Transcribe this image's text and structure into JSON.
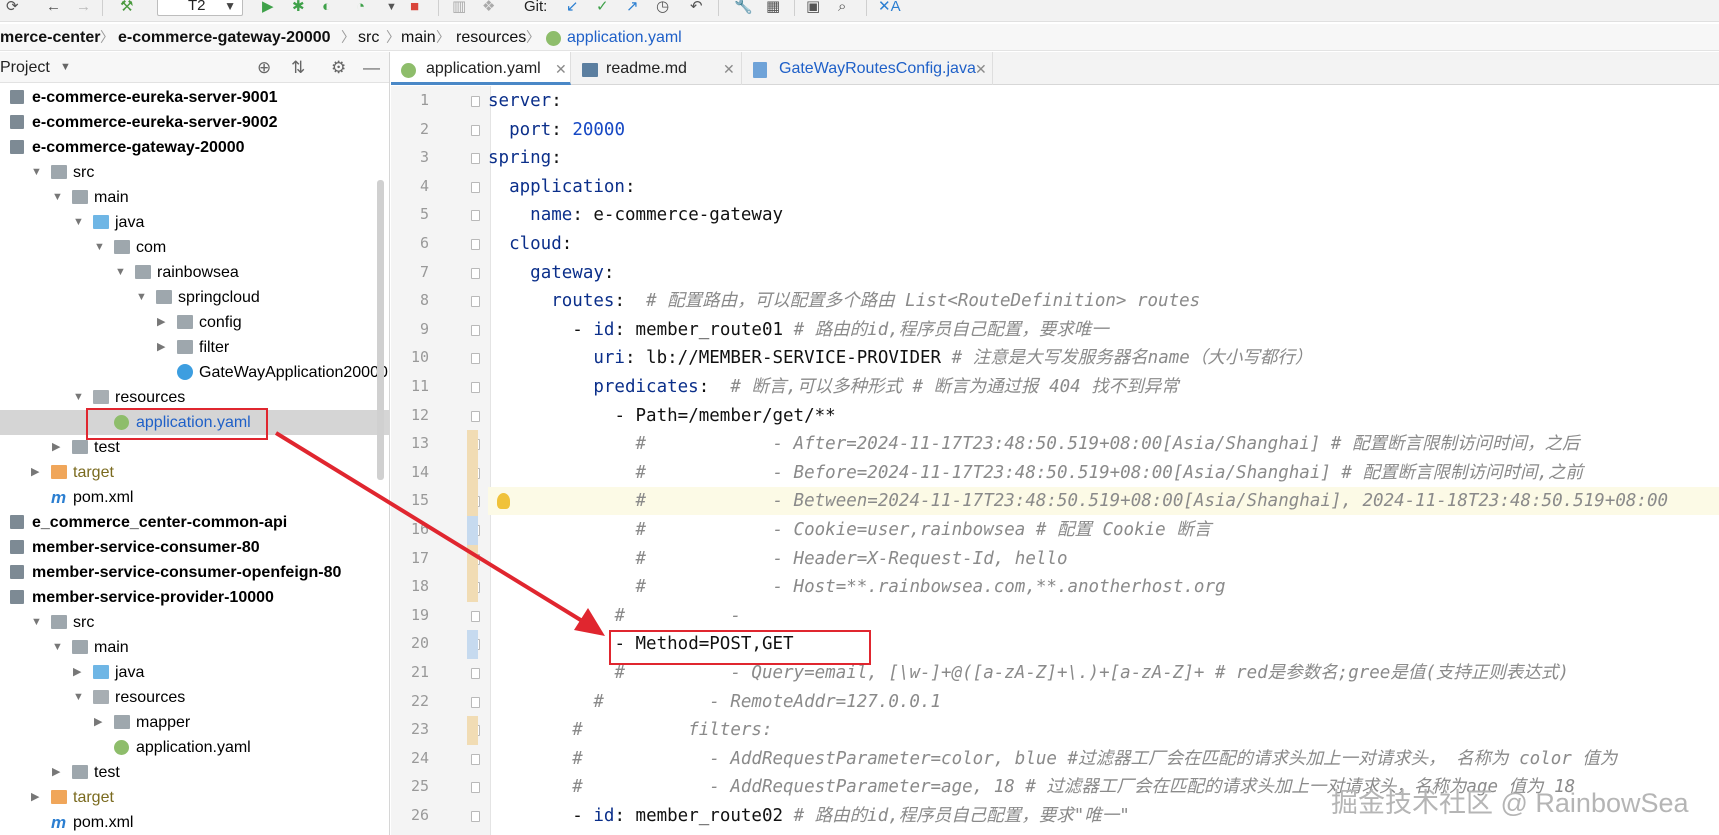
{
  "toolbar": {
    "run_config": "T2",
    "git_label": "Git:",
    "icons": [
      "sync-icon",
      "back-icon",
      "forward-icon",
      "hammer-icon",
      "run-icon",
      "debug-icon",
      "coverage-icon",
      "profile-icon",
      "stop-icon",
      "git-update-icon",
      "git-commit-icon",
      "git-push-icon",
      "history-icon",
      "rollback-icon",
      "settings-icon",
      "project-structure-icon",
      "terminal-icon",
      "search-icon",
      "translate-icon"
    ]
  },
  "breadcrumb": {
    "items": [
      "merce-center",
      "e-commerce-gateway-20000",
      "src",
      "main",
      "resources",
      "application.yaml"
    ]
  },
  "project_panel": {
    "title": "Project",
    "tree": [
      {
        "label": "e-commerce-eureka-server-9001",
        "depth": 0,
        "kind": "module",
        "arrow": "",
        "bold": true
      },
      {
        "label": "e-commerce-eureka-server-9002",
        "depth": 0,
        "kind": "module",
        "arrow": "",
        "bold": true
      },
      {
        "label": "e-commerce-gateway-20000",
        "depth": 0,
        "kind": "module",
        "arrow": "",
        "bold": true
      },
      {
        "label": "src",
        "depth": 1,
        "kind": "folder",
        "arrow": "open",
        "bold": false
      },
      {
        "label": "main",
        "depth": 2,
        "kind": "folder",
        "arrow": "open",
        "bold": false
      },
      {
        "label": "java",
        "depth": 3,
        "kind": "folder-blue",
        "arrow": "open",
        "bold": false
      },
      {
        "label": "com",
        "depth": 4,
        "kind": "folder",
        "arrow": "open",
        "bold": false
      },
      {
        "label": "rainbowsea",
        "depth": 5,
        "kind": "folder",
        "arrow": "open",
        "bold": false
      },
      {
        "label": "springcloud",
        "depth": 6,
        "kind": "folder",
        "arrow": "open",
        "bold": false
      },
      {
        "label": "config",
        "depth": 7,
        "kind": "folder",
        "arrow": "closed",
        "bold": false
      },
      {
        "label": "filter",
        "depth": 7,
        "kind": "folder",
        "arrow": "closed",
        "bold": false
      },
      {
        "label": "GateWayApplication20000",
        "depth": 7,
        "kind": "class",
        "arrow": "",
        "bold": false
      },
      {
        "label": "resources",
        "depth": 3,
        "kind": "folder-res",
        "arrow": "open",
        "bold": false
      },
      {
        "label": "application.yaml",
        "depth": 4,
        "kind": "yaml",
        "arrow": "",
        "bold": false,
        "selected": true
      },
      {
        "label": "test",
        "depth": 2,
        "kind": "folder",
        "arrow": "closed",
        "bold": false
      },
      {
        "label": "target",
        "depth": 1,
        "kind": "folder-orange",
        "arrow": "closed",
        "bold": false,
        "olive": true
      },
      {
        "label": "pom.xml",
        "depth": 1,
        "kind": "maven",
        "arrow": "",
        "bold": false
      },
      {
        "label": "e_commerce_center-common-api",
        "depth": 0,
        "kind": "module",
        "arrow": "",
        "bold": true
      },
      {
        "label": "member-service-consumer-80",
        "depth": 0,
        "kind": "module",
        "arrow": "",
        "bold": true
      },
      {
        "label": "member-service-consumer-openfeign-80",
        "depth": 0,
        "kind": "module",
        "arrow": "",
        "bold": true
      },
      {
        "label": "member-service-provider-10000",
        "depth": 0,
        "kind": "module",
        "arrow": "",
        "bold": true
      },
      {
        "label": "src",
        "depth": 1,
        "kind": "folder",
        "arrow": "open",
        "bold": false
      },
      {
        "label": "main",
        "depth": 2,
        "kind": "folder",
        "arrow": "open",
        "bold": false
      },
      {
        "label": "java",
        "depth": 3,
        "kind": "folder-blue",
        "arrow": "closed",
        "bold": false
      },
      {
        "label": "resources",
        "depth": 3,
        "kind": "folder-res",
        "arrow": "open",
        "bold": false
      },
      {
        "label": "mapper",
        "depth": 4,
        "kind": "folder",
        "arrow": "closed",
        "bold": false
      },
      {
        "label": "application.yaml",
        "depth": 4,
        "kind": "yaml",
        "arrow": "",
        "bold": false
      },
      {
        "label": "test",
        "depth": 2,
        "kind": "folder",
        "arrow": "closed",
        "bold": false
      },
      {
        "label": "target",
        "depth": 1,
        "kind": "folder-orange",
        "arrow": "closed",
        "bold": false,
        "olive": true
      },
      {
        "label": "pom.xml",
        "depth": 1,
        "kind": "maven",
        "arrow": "",
        "bold": false
      }
    ]
  },
  "editor_tabs": [
    {
      "label": "application.yaml",
      "icon": "yaml-icon",
      "active": true
    },
    {
      "label": "readme.md",
      "icon": "markdown-icon",
      "active": false
    },
    {
      "label": "GateWayRoutesConfig.java",
      "icon": "java-class-icon",
      "active": false
    }
  ],
  "editor": {
    "lines": [
      {
        "n": "1",
        "ind": 0,
        "k": "server",
        "v": "",
        "c": ""
      },
      {
        "n": "2",
        "ind": 2,
        "k": "port",
        "v": "",
        "num": "20000",
        "c": ""
      },
      {
        "n": "3",
        "ind": 0,
        "k": "spring",
        "v": "",
        "c": ""
      },
      {
        "n": "4",
        "ind": 2,
        "k": "application",
        "v": "",
        "c": ""
      },
      {
        "n": "5",
        "ind": 4,
        "k": "name",
        "v": "e-commerce-gateway",
        "c": ""
      },
      {
        "n": "6",
        "ind": 2,
        "k": "cloud",
        "v": "",
        "c": ""
      },
      {
        "n": "7",
        "ind": 4,
        "k": "gateway",
        "v": "",
        "c": ""
      },
      {
        "n": "8",
        "ind": 6,
        "k": "routes",
        "v": "",
        "c": "# 配置路由，可以配置多个路由 List<RouteDefinition> routes"
      },
      {
        "n": "9",
        "ind": 8,
        "dash": true,
        "k": "id",
        "v": "member_route01",
        "c": "# 路由的id,程序员自己配置，要求唯一"
      },
      {
        "n": "10",
        "ind": 10,
        "k": "uri",
        "v": "lb://MEMBER-SERVICE-PROVIDER",
        "c": "# 注意是大写发服务器名name（大小写都行）"
      },
      {
        "n": "11",
        "ind": 10,
        "k": "predicates",
        "v": "",
        "c": "# 断言,可以多种形式 # 断言为通过报 404 找不到异常"
      },
      {
        "n": "12",
        "ind": 12,
        "raw": "- Path=/member/get/**"
      },
      {
        "n": "13",
        "ind": 14,
        "comment": "#            - After=2024-11-17T23:48:50.519+08:00[Asia/Shanghai] # 配置断言限制访问时间，之后"
      },
      {
        "n": "14",
        "ind": 14,
        "comment": "#            - Before=2024-11-17T23:48:50.519+08:00[Asia/Shanghai] # 配置断言限制访问时间,之前"
      },
      {
        "n": "15",
        "ind": 14,
        "comment": "#            - Between=2024-11-17T23:48:50.519+08:00[Asia/Shanghai], 2024-11-18T23:48:50.519+08:00",
        "hl": true
      },
      {
        "n": "16",
        "ind": 14,
        "comment": "#            - Cookie=user,rainbowsea # 配置 Cookie 断言"
      },
      {
        "n": "17",
        "ind": 14,
        "comment": "#            - Header=X-Request-Id, hello"
      },
      {
        "n": "18",
        "ind": 14,
        "comment": "#            - Host=**.rainbowsea.com,**.anotherhost.org"
      },
      {
        "n": "19",
        "ind": 12,
        "comment": "#          -"
      },
      {
        "n": "20",
        "ind": 12,
        "raw": "- Method=POST,GET"
      },
      {
        "n": "21",
        "ind": 12,
        "comment": "#          - Query=email, [\\w-]+@([a-zA-Z]+\\.)+[a-zA-Z]+ # red是参数名;gree是值(支持正则表达式)"
      },
      {
        "n": "22",
        "ind": 10,
        "comment": "#          - RemoteAddr=127.0.0.1"
      },
      {
        "n": "23",
        "ind": 8,
        "comment": "#          filters:"
      },
      {
        "n": "24",
        "ind": 8,
        "comment": "#            - AddRequestParameter=color, blue #过滤器工厂会在匹配的请求头加上一对请求头， 名称为 color 值为"
      },
      {
        "n": "25",
        "ind": 8,
        "comment": "#            - AddRequestParameter=age, 18 # 过滤器工厂会在匹配的请求头加上一对请求头，名称为age 值为 18"
      },
      {
        "n": "26",
        "ind": 8,
        "dash": true,
        "k": "id",
        "v": "member_route02",
        "c": "# 路由的id,程序员自己配置，要求\"唯一\""
      }
    ]
  },
  "watermark": "掘金技术社区 @ RainbowSea",
  "colors": {
    "annotation_red": "#e0262f",
    "selection": "#d5d5d5",
    "keyword": "#0b2f8a",
    "number": "#1648c4",
    "comment": "#8a8a8a"
  }
}
